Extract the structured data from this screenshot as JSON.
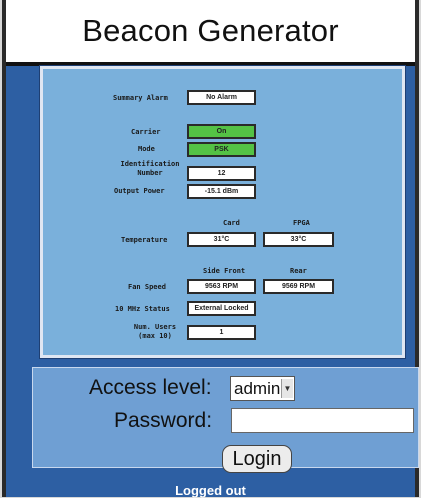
{
  "app": {
    "title": "Beacon Generator"
  },
  "status": {
    "summary_alarm": {
      "label": "Summary Alarm",
      "value": "No Alarm"
    },
    "carrier": {
      "label": "Carrier",
      "value": "On"
    },
    "mode": {
      "label": "Mode",
      "value": "PSK"
    },
    "identification_number": {
      "label_line1": "Identification",
      "label_line2": "Number",
      "value": "12"
    },
    "output_power": {
      "label": "Output Power",
      "value": "-15.1 dBm"
    },
    "temperature": {
      "label": "Temperature",
      "col1_header": "Card",
      "col2_header": "FPGA",
      "col1_value": "31°C",
      "col2_value": "33°C"
    },
    "fan_speed": {
      "label": "Fan Speed",
      "col1_header": "Side Front",
      "col2_header": "Rear",
      "col1_value": "9563 RPM",
      "col2_value": "9569 RPM"
    },
    "ten_mhz_status": {
      "label": "10 MHz Status",
      "value": "External Locked"
    },
    "num_users": {
      "label_line1": "Num. Users",
      "label_line2": "(max 10)",
      "value": "1"
    }
  },
  "login": {
    "access_level_label": "Access level:",
    "access_level_value": "admin",
    "password_label": "Password:",
    "password_value": "",
    "login_button_label": "Login"
  },
  "footer": {
    "status_text": "Logged out"
  },
  "colors": {
    "background_blue": "#2d5fa3",
    "panel_blue": "#7ab0db",
    "login_panel_blue": "#6f9fd3",
    "status_green": "#54c245"
  }
}
